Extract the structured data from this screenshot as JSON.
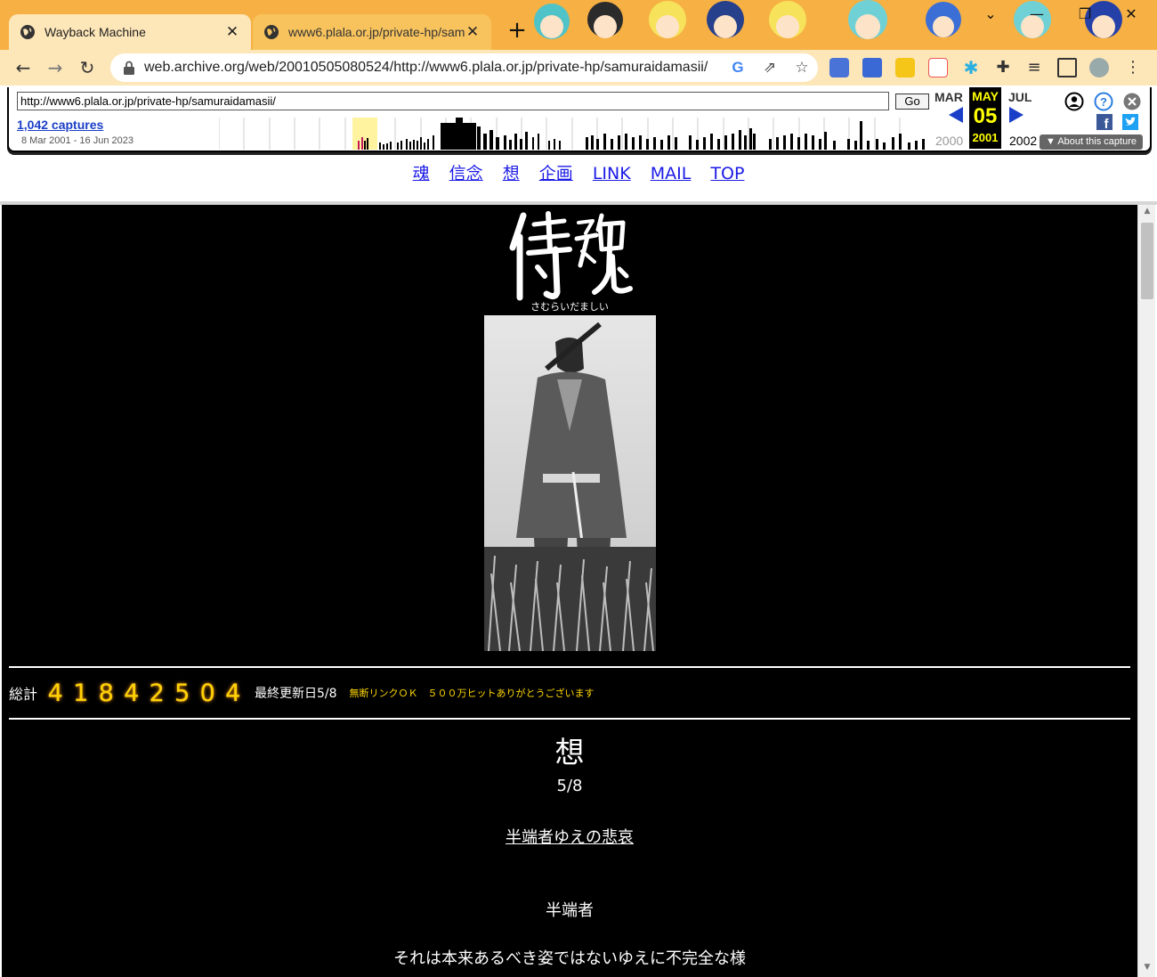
{
  "browser": {
    "tabs": [
      {
        "label": "Wayback Machine"
      },
      {
        "label": "www6.plala.or.jp/private-hp/sam"
      }
    ],
    "url": "web.archive.org/web/20010505080524/http://www6.plala.or.jp/private-hp/samuraidamasii/"
  },
  "wayback": {
    "url_field": "http://www6.plala.or.jp/private-hp/samuraidamasii/",
    "go_label": "Go",
    "captures": "1,042 captures",
    "range": "8 Mar 2001 - 16 Jun 2023",
    "prev_month": "MAR",
    "cur_month": "MAY",
    "next_month": "JUL",
    "prev_year": "2000",
    "cur_day": "05",
    "cur_year": "2001",
    "next_year": "2002",
    "about": "About this capture"
  },
  "site_nav": [
    "魂",
    "信念",
    "想",
    "企画",
    "LINK",
    "MAIL",
    "TOP"
  ],
  "page": {
    "logo_ruby": "さむらいだましい",
    "counter_label": "総計",
    "counter_digits": [
      "4",
      "1",
      "8",
      "4",
      "2",
      "5",
      "0",
      "4"
    ],
    "updated": "最終更新日5/8",
    "notice": "無断リンクＯＫ　５００万ヒットありがとうございます",
    "section_title": "想",
    "section_date": "5/8",
    "article_link": "半端者ゆえの悲哀",
    "para1": "半端者",
    "para2": "それは本来あるべき姿ではないゆえに不完全な様"
  },
  "colors": {
    "theme": "#f6b043",
    "toolbar": "#fde6b8",
    "link": "#1a1ae6",
    "counter": "#ffd100",
    "notice": "#ffd700"
  }
}
